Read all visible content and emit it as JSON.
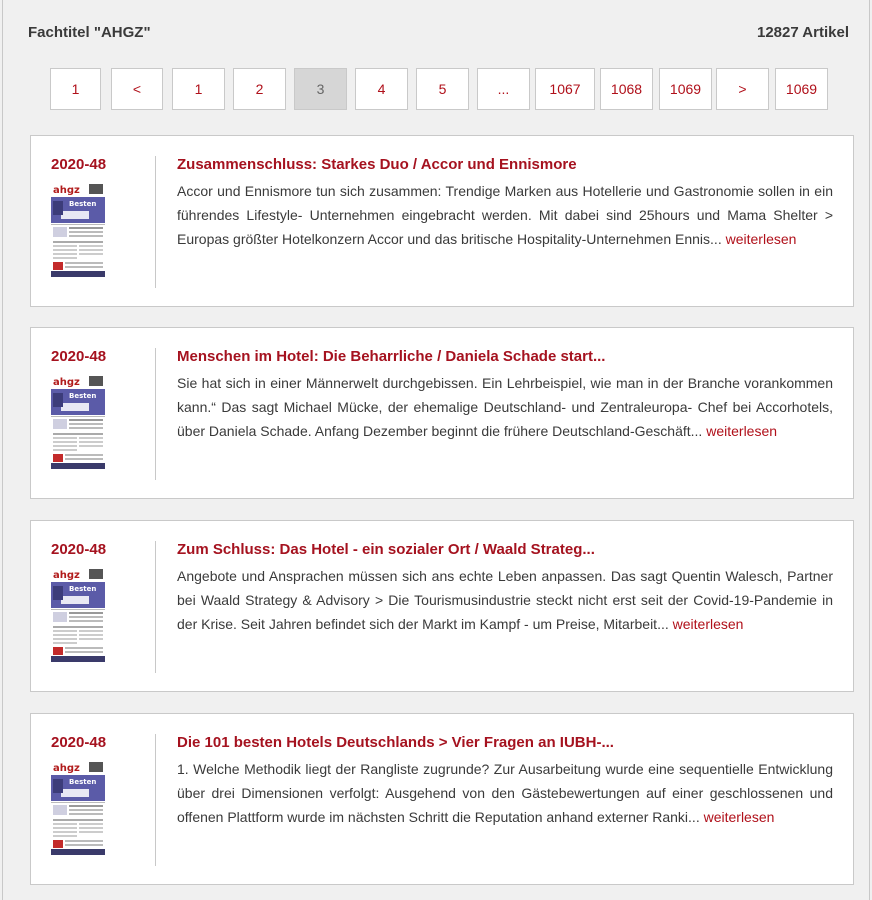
{
  "header": {
    "title": "Fachtitel \"AHGZ\"",
    "count": "12827 Artikel"
  },
  "pager": [
    {
      "label": "1",
      "name": "pager-first"
    },
    {
      "label": "<",
      "name": "pager-prev"
    },
    {
      "label": "1",
      "name": "pager-page-1"
    },
    {
      "label": "2",
      "name": "pager-page-2"
    },
    {
      "label": "3",
      "name": "pager-page-3-current"
    },
    {
      "label": "4",
      "name": "pager-page-4"
    },
    {
      "label": "5",
      "name": "pager-page-5"
    },
    {
      "label": "...",
      "name": "pager-ellipsis"
    },
    {
      "label": "1067",
      "name": "pager-page-1067"
    },
    {
      "label": "1068",
      "name": "pager-page-1068"
    },
    {
      "label": "1069",
      "name": "pager-page-1069"
    },
    {
      "label": ">",
      "name": "pager-next"
    },
    {
      "label": "1069",
      "name": "pager-last"
    }
  ],
  "current_page": "3",
  "colors": {
    "accent": "#a5121f",
    "link": "#b0101a",
    "background": "#f0f0f0"
  },
  "articles": [
    {
      "issue": "2020-48",
      "headline": "Zusammenschluss: Starkes Duo / Accor und Ennismore",
      "teaser": "Accor und Ennismore tun sich zusammen: Trendige Marken aus Hotellerie und Gastronomie sollen in ein führendes Lifestyle- Unternehmen eingebracht werden. Mit dabei sind 25hours und Mama Shelter > Europas größter Hotelkonzern Accor und das britische Hospitality-Unternehmen Ennis...",
      "more": "weiterlesen"
    },
    {
      "issue": "2020-48",
      "headline": "Menschen im Hotel: Die Beharrliche / Daniela Schade start...",
      "teaser": "Sie hat sich in einer Männerwelt durchgebissen. Ein Lehrbeispiel, wie man in der Branche vorankommen kann.“ Das sagt Michael Mücke, der ehemalige Deutschland- und Zentraleuropa- Chef bei Accorhotels, über Daniela Schade. Anfang Dezember beginnt die frühere Deutschland-Geschäft...",
      "more": "weiterlesen"
    },
    {
      "issue": "2020-48",
      "headline": "Zum Schluss: Das Hotel - ein sozialer Ort / Waald Strateg...",
      "teaser": "Angebote und Ansprachen müssen sich ans echte Leben anpassen. Das sagt Quentin Walesch, Partner bei Waald Strategy & Advisory > Die Tourismusindustrie steckt nicht erst seit der Covid-19-Pandemie in der Krise. Seit Jahren befindet sich der Markt im Kampf - um Preise, Mitarbeit...",
      "more": "weiterlesen"
    },
    {
      "issue": "2020-48",
      "headline": "Die 101 besten Hotels Deutschlands > Vier Fragen an IUBH-...",
      "teaser": "1. Welche Methodik liegt der Rangliste zugrunde? Zur Ausarbeitung wurde eine sequentielle Entwicklung über drei Dimensionen verfolgt: Ausgehend von den Gästebewertungen auf einer geschlossenen und offenen Plattform wurde im nächsten Schritt die Reputation anhand externer Ranki...",
      "more": "weiterlesen"
    }
  ],
  "thumbnail": {
    "masthead": "ahgz",
    "cover_word": "Besten"
  }
}
